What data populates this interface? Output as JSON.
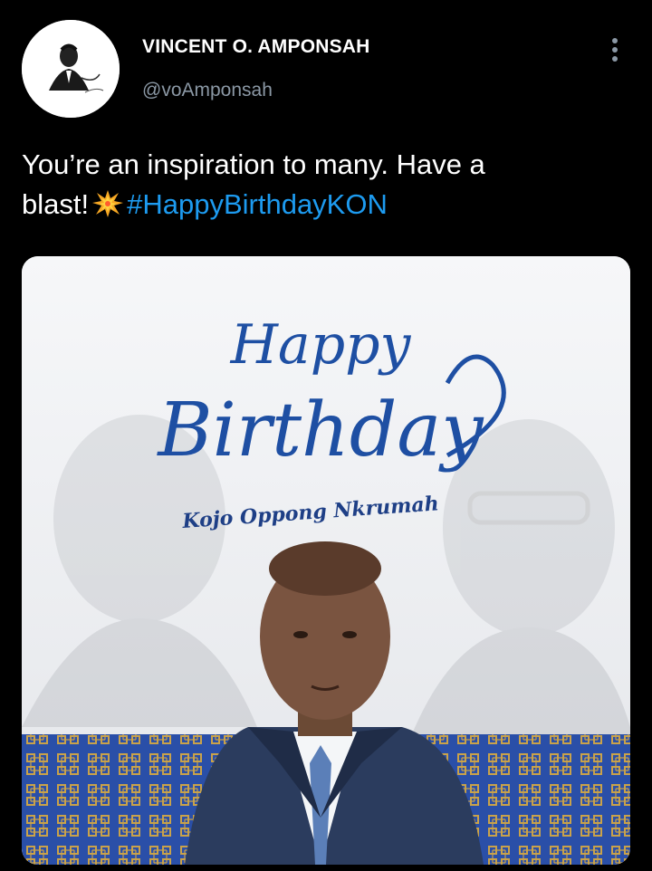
{
  "author": {
    "name": "VINCENT O. AMPONSAH",
    "handle": "@voAmponsah",
    "avatar": "avatar-icon"
  },
  "tweet": {
    "text_part1": "You’re an inspiration to many. Have a",
    "text_part2": "blast!",
    "emoji": "collision-icon",
    "hashtag": "#HappyBirthdayKON"
  },
  "media": {
    "headline_line1": "Happy",
    "headline_line2": "Birthday",
    "subtitle": "Kojo Oppong Nkrumah",
    "colors": {
      "script_blue": "#1e4fa3",
      "pattern_blue": "#2a4fa8",
      "pattern_gold": "#c9a24a",
      "background": "#f1f2f4"
    }
  },
  "colors": {
    "link": "#1d9bf0",
    "secondary": "#8b98a5",
    "background": "#000000"
  }
}
